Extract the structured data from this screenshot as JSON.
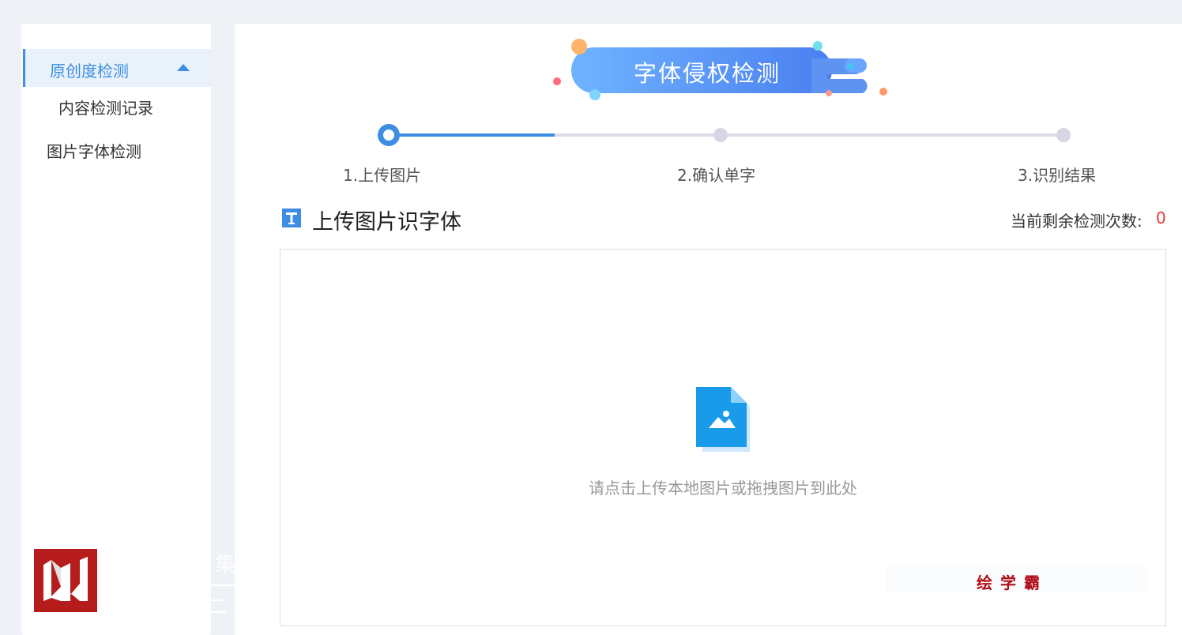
{
  "sidebar": {
    "group_label": "原创度检测",
    "sub_item": "内容检测记录",
    "item": "图片字体检测"
  },
  "overlay": {
    "ghost_text_1": "集",
    "ghost_text_2": "二"
  },
  "banner": {
    "title": "字体侵权检测"
  },
  "steps": {
    "current": 1,
    "items": [
      {
        "label": "1.上传图片"
      },
      {
        "label": "2.确认单字"
      },
      {
        "label": "3.识别结果"
      }
    ]
  },
  "section": {
    "icon_glyph": "T",
    "title": "上传图片识字体",
    "remaining_label": "当前剩余检测次数:",
    "remaining_count": "0"
  },
  "upload": {
    "hint": "请点击上传本地图片或拖拽图片到此处"
  },
  "watermark": {
    "text": "绘学霸"
  },
  "colors": {
    "accent": "#3d8ee2",
    "danger": "#e4393c",
    "logo": "#b71c1c"
  }
}
